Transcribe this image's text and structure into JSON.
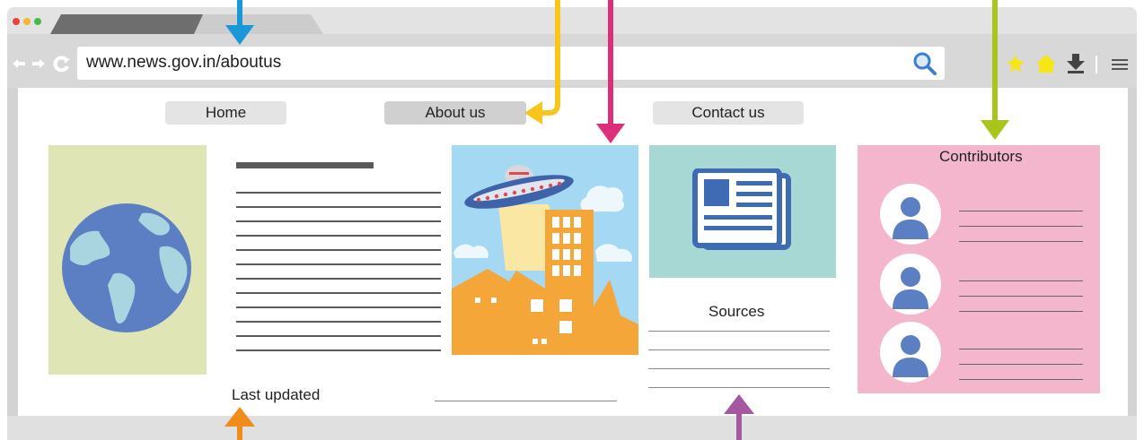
{
  "browser": {
    "url": "www.news.gov.in/aboutus",
    "icons": [
      "back-arrow-icon",
      "forward-arrow-icon",
      "reload-icon",
      "search-icon",
      "star-icon",
      "home-icon",
      "download-icon",
      "menu-icon"
    ]
  },
  "nav": {
    "home": "Home",
    "about": "About us",
    "contact": "Contact us"
  },
  "sections": {
    "sources_title": "Sources",
    "contributors_title": "Contributors",
    "last_updated": "Last updated"
  },
  "colors": {
    "arrow_blue": "#1a98d5",
    "arrow_yellow": "#f7c51c",
    "arrow_magenta": "#dc2e7a",
    "arrow_green": "#a9c51c",
    "arrow_orange": "#f08c1b",
    "arrow_purple": "#a558a0",
    "globe_panel": "#dfe5b5",
    "news_panel": "#a8d8d4",
    "contributors_panel": "#f4b6cc",
    "accent_blue": "#5b7fc2"
  }
}
